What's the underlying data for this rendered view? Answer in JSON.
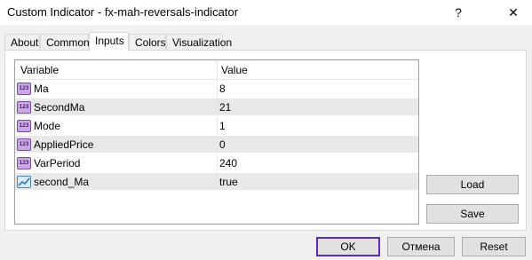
{
  "window": {
    "title": "Custom Indicator - fx-mah-reversals-indicator",
    "help_label": "?",
    "close_label": "✕"
  },
  "tabs": [
    {
      "label": "About"
    },
    {
      "label": "Common"
    },
    {
      "label": "Inputs"
    },
    {
      "label": "Colors"
    },
    {
      "label": "Visualization"
    }
  ],
  "active_tab": "Inputs",
  "grid": {
    "columns": {
      "variable": "Variable",
      "value": "Value"
    },
    "rows": [
      {
        "icon": "integer-icon",
        "icon_text": "123",
        "name": "Ma",
        "value": "8"
      },
      {
        "icon": "integer-icon",
        "icon_text": "123",
        "name": "SecondMa",
        "value": "21"
      },
      {
        "icon": "integer-icon",
        "icon_text": "123",
        "name": "Mode",
        "value": "1"
      },
      {
        "icon": "integer-icon",
        "icon_text": "123",
        "name": "AppliedPrice",
        "value": "0"
      },
      {
        "icon": "integer-icon",
        "icon_text": "123",
        "name": "VarPeriod",
        "value": "240"
      },
      {
        "icon": "line-icon",
        "icon_text": "",
        "name": "second_Ma",
        "value": "true"
      }
    ]
  },
  "side_buttons": {
    "load": "Load",
    "save": "Save"
  },
  "footer": {
    "ok": "OK",
    "cancel": "Отмена",
    "reset": "Reset"
  },
  "colors": {
    "accent_border": "#5b2cb8",
    "row_alt": "#e8e8e8",
    "int_icon": "#c9a7e3"
  }
}
